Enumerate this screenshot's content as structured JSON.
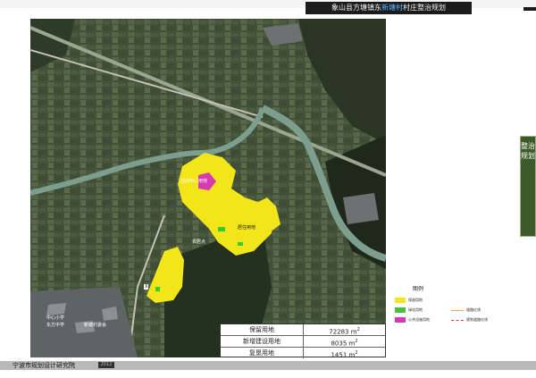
{
  "header": {
    "title_part1": "象山县方塘镇东",
    "title_part2": "新塘村",
    "title_part3": "村庄整治规划",
    "highlight_color": "#5fb6ff"
  },
  "side_tab": {
    "text": "整治规划"
  },
  "map": {
    "labels": {
      "label1": "活动中心用地",
      "label2": "居住用地",
      "label3": "农居点",
      "label4": "中心小学",
      "label5": "X",
      "label6": "东方中学",
      "label7": "新塘村委会"
    },
    "colors": {
      "residential": "#f2e51a",
      "public": "#d63ab3",
      "green": "#33cc33",
      "river": "#7d9e8e"
    }
  },
  "stats": {
    "rows": [
      {
        "label": "保留用地",
        "value": "72283",
        "unit": "m",
        "sup": "2"
      },
      {
        "label": "新增建设用地",
        "value": "8035",
        "unit": "m",
        "sup": "2"
      },
      {
        "label": "复垦用地",
        "value": "1451",
        "unit": "m",
        "sup": "2"
      }
    ]
  },
  "legend": {
    "title": "图例",
    "items": [
      {
        "label": "保留用地",
        "color": "#f2e51a"
      },
      {
        "label": "绿化用地",
        "color": "#4bbf3a"
      },
      {
        "label": "公共设施用地",
        "color": "#d63ab3"
      },
      {
        "label": "道路红线",
        "line_color": "#e8a85c"
      },
      {
        "label": "规划道路红线",
        "line_color": "#ff2a2a"
      }
    ]
  },
  "footer": {
    "text": "宁波市规划设计研究院",
    "badge": "2012"
  }
}
